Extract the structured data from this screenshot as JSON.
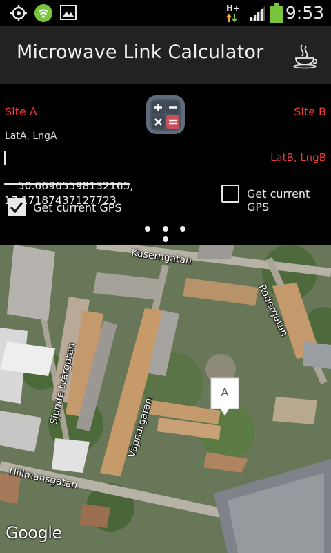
{
  "status_bar": {
    "icons": [
      "gps-icon",
      "wifi-icon",
      "image-icon",
      "hplus-data-icon",
      "signal-icon",
      "battery-icon"
    ],
    "network_type": "H+",
    "time": "9:53"
  },
  "action_bar": {
    "title": "Microwave Link Calculator",
    "menu_icon": "coffee-icon"
  },
  "panel": {
    "site_a_label": "Site A",
    "site_b_label": "Site B",
    "site_a_coords_label": "LatA, LngA",
    "site_b_coords_hint": "LatB, LngB",
    "site_a_coords_value": "50.66965598132165,\n17.17187437127723",
    "site_a_gps_label": "Get current GPS",
    "site_a_gps_checked": true,
    "site_b_gps_label": "Get current GPS",
    "site_b_gps_checked": false,
    "center_icon": "calculator-icon"
  },
  "map": {
    "streets": [
      "Kaserngatan",
      "Rodergatan",
      "Sjunde tvärgatan",
      "Väpnargatan",
      "Hillmansgatan"
    ],
    "marker_label": "A",
    "attribution": "Google"
  },
  "colors": {
    "accent_red": "#ee3a3a",
    "actionbar_bg": "#222222",
    "panel_bg": "#000000"
  }
}
